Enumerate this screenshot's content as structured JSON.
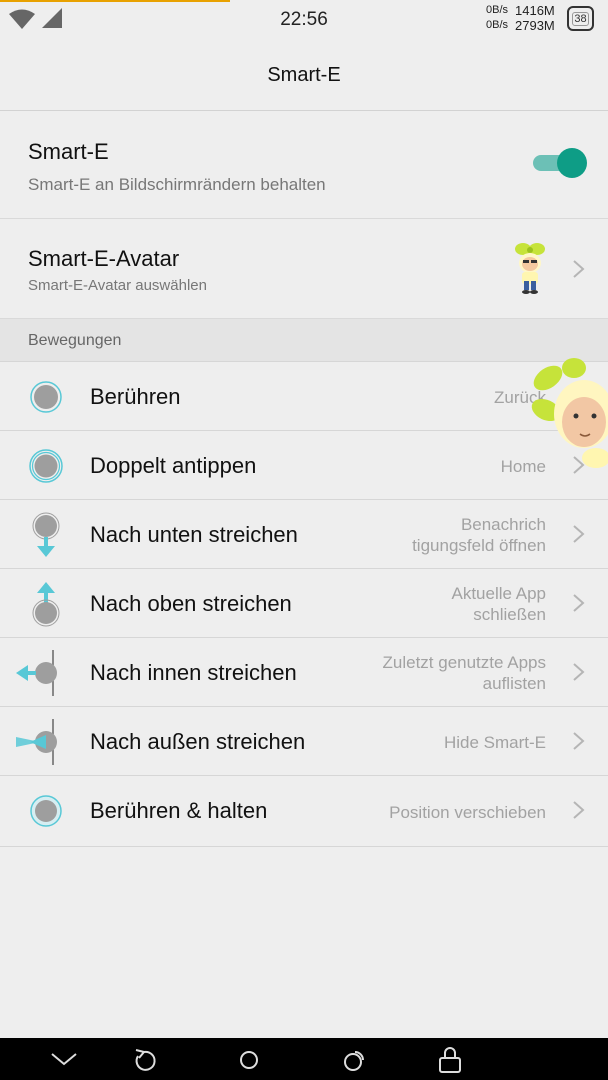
{
  "status_bar": {
    "time": "22:56",
    "net_speed_up": "0B/s",
    "net_speed_down": "0B/s",
    "net_size_1": "1416M",
    "net_size_2": "2793M",
    "battery": "38"
  },
  "header": {
    "title": "Smart-E"
  },
  "smart_e": {
    "title": "Smart-E",
    "subtitle": "Smart-E an Bildschirmrändern behalten",
    "enabled": true
  },
  "avatar": {
    "title": "Smart-E-Avatar",
    "subtitle": "Smart-E-Avatar auswählen"
  },
  "section": {
    "title": "Bewegungen"
  },
  "gestures": [
    {
      "label": "Berühren",
      "value_line1": "Zurück",
      "value_line2": ""
    },
    {
      "label": "Doppelt antippen",
      "value_line1": "Home",
      "value_line2": ""
    },
    {
      "label": "Nach unten streichen",
      "value_line1": "Benachrich",
      "value_line2": "tigungsfeld öffnen"
    },
    {
      "label": "Nach oben streichen",
      "value_line1": "Aktuelle App",
      "value_line2": "schließen"
    },
    {
      "label": "Nach innen streichen",
      "value_line1": "Zuletzt genutzte Apps",
      "value_line2": "auflisten"
    },
    {
      "label": "Nach außen streichen",
      "value_line1": "Hide Smart-E",
      "value_line2": ""
    },
    {
      "label": "Berühren & halten",
      "value_line1": "Position verschieben",
      "value_line2": ""
    }
  ],
  "colors": {
    "accent": "#0e9d86",
    "accent_track": "#6cc0b6",
    "icon_cyan": "#58c8d6"
  },
  "icons": {
    "nav": [
      "collapse-icon",
      "back-icon",
      "home-icon",
      "recent-apps-icon",
      "lock-icon"
    ]
  }
}
